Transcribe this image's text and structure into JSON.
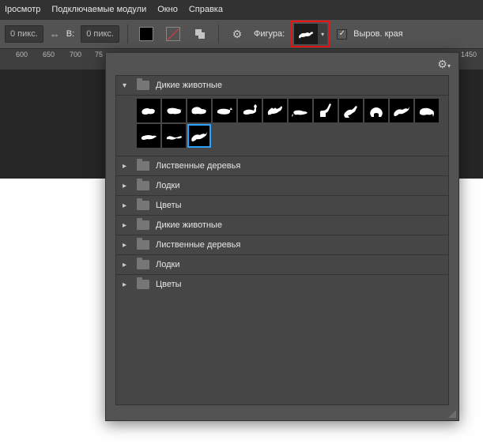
{
  "menu": {
    "items": [
      "Iросмотр",
      "Подключаемые модули",
      "Окно",
      "Справка"
    ]
  },
  "toolbar": {
    "inputX": "0 пикс.",
    "link_label": "",
    "width_label": "В:",
    "inputW": "0 пикс.",
    "shape_label": "Фигура:",
    "align_edges_label": "Выров. края",
    "align_edges_checked": "✓"
  },
  "ruler": {
    "ticks": [
      "600",
      "650",
      "700",
      "75"
    ],
    "ticks_right": [
      "1450"
    ]
  },
  "panel": {
    "folders": [
      {
        "label": "Дикие животные",
        "expanded": true
      },
      {
        "label": "Лиственные деревья",
        "expanded": false
      },
      {
        "label": "Лодки",
        "expanded": false
      },
      {
        "label": "Цветы",
        "expanded": false
      },
      {
        "label": "Дикие животные",
        "expanded": false
      },
      {
        "label": "Лиственные деревья",
        "expanded": false
      },
      {
        "label": "Лодки",
        "expanded": false
      },
      {
        "label": "Цветы",
        "expanded": false
      }
    ],
    "shapes": [
      "bear",
      "pig",
      "bison",
      "rhino",
      "moose",
      "camel",
      "rat",
      "giraffe",
      "kangaroo",
      "gorilla",
      "leaping-deer",
      "elephant",
      "cheetah",
      "lizard",
      "deer"
    ],
    "selected_shape_index": 14,
    "preview_shape": "leaping-deer"
  },
  "colors": {
    "highlight": "#e11",
    "selection": "#2aa3ff"
  }
}
